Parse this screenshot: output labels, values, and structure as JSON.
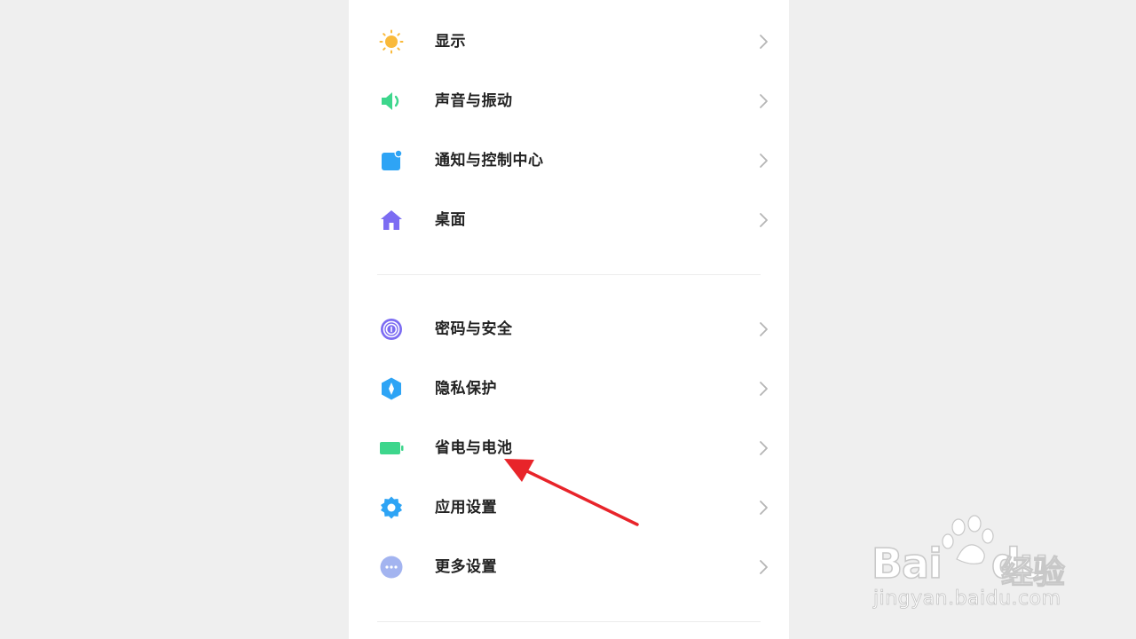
{
  "settings": {
    "group1": [
      {
        "label": "显示",
        "icon": "sun-icon",
        "color": "#F9B93A"
      },
      {
        "label": "声音与振动",
        "icon": "speaker-icon",
        "color": "#3DD68C"
      },
      {
        "label": "通知与控制中心",
        "icon": "notification-icon",
        "color": "#2EA4F5"
      },
      {
        "label": "桌面",
        "icon": "home-icon",
        "color": "#7C6CF2"
      }
    ],
    "group2": [
      {
        "label": "密码与安全",
        "icon": "fingerprint-icon",
        "color": "#7C6CF2"
      },
      {
        "label": "隐私保护",
        "icon": "privacy-shield-icon",
        "color": "#2EA4F5"
      },
      {
        "label": "省电与电池",
        "icon": "battery-icon",
        "color": "#3DD68C"
      },
      {
        "label": "应用设置",
        "icon": "gear-icon",
        "color": "#2EA4F5"
      },
      {
        "label": "更多设置",
        "icon": "more-icon",
        "color": "#A3B4F0"
      }
    ]
  },
  "annotation": {
    "arrow_color": "#E8242A",
    "target": "省电与电池"
  },
  "watermark": {
    "brand": "Bai",
    "brand2": "du",
    "cn": "经验",
    "url": "jingyan.baidu.com"
  }
}
